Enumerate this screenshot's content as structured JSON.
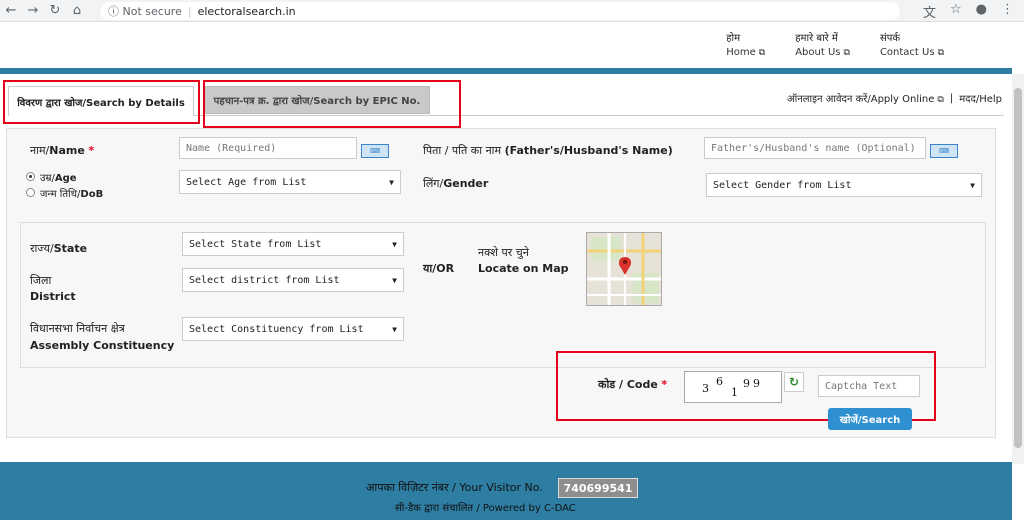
{
  "browser": {
    "security": "Not secure",
    "url": "electoralsearch.in"
  },
  "toplinks": [
    {
      "hi": "होम",
      "en": "Home"
    },
    {
      "hi": "हमारे बारे में",
      "en": "About Us"
    },
    {
      "hi": "संपर्क",
      "en": "Contact Us"
    }
  ],
  "tabs": {
    "details": "विवरण द्वारा खोज/Search by Details",
    "epic": "पहचान-पत्र क्र. द्वारा खोज/Search by EPIC No."
  },
  "header_links": {
    "apply": "ऑनलाइन आवेदन करें/Apply Online",
    "sep": "|",
    "help": "मदद/Help"
  },
  "form": {
    "name_label_hi": "नाम/",
    "name_label_en": "Name",
    "required_mark": "*",
    "name_placeholder": "Name (Required)",
    "father_label_hi": "पिता / पति का नाम ",
    "father_label_en": "(Father's/Husband's Name)",
    "father_placeholder": "Father's/Husband's name (Optional)",
    "age_label_hi": "उम्र/",
    "age_label_en": "Age",
    "dob_label_hi": "जन्म तिथि/",
    "dob_label_en": "DoB",
    "age_select": "Select Age from List",
    "gender_label_hi": "लिंग/",
    "gender_label_en": "Gender",
    "gender_select": "Select Gender from List",
    "state_label_hi": "राज्य/",
    "state_label_en": "State",
    "state_select": "Select State from List",
    "district_label_hi": "जिला",
    "district_label_en": "District",
    "district_select": "Select district from List",
    "ac_label_hi": "विधानसभा निर्वाचन क्षेत्र",
    "ac_label_en": "Assembly Constituency",
    "ac_select": "Select Constituency from List",
    "or_label": "या/OR",
    "map_label_hi": "नक्शे पर चुने",
    "map_label_en": "Locate on Map",
    "code_label": "कोड / Code",
    "captcha_chars": [
      "3",
      "6",
      "1",
      "9",
      "9"
    ],
    "captcha_placeholder": "Captcha Text",
    "search_button": "खोजें/Search",
    "keyboard_icon_text": "⌨"
  },
  "footer": {
    "visitor_label": "आपका विज़िटर नंबर / Your Visitor No.",
    "visitor_count": "740699541",
    "powered_by": "सी-डैक द्वारा संचालित / Powered by C-DAC"
  }
}
